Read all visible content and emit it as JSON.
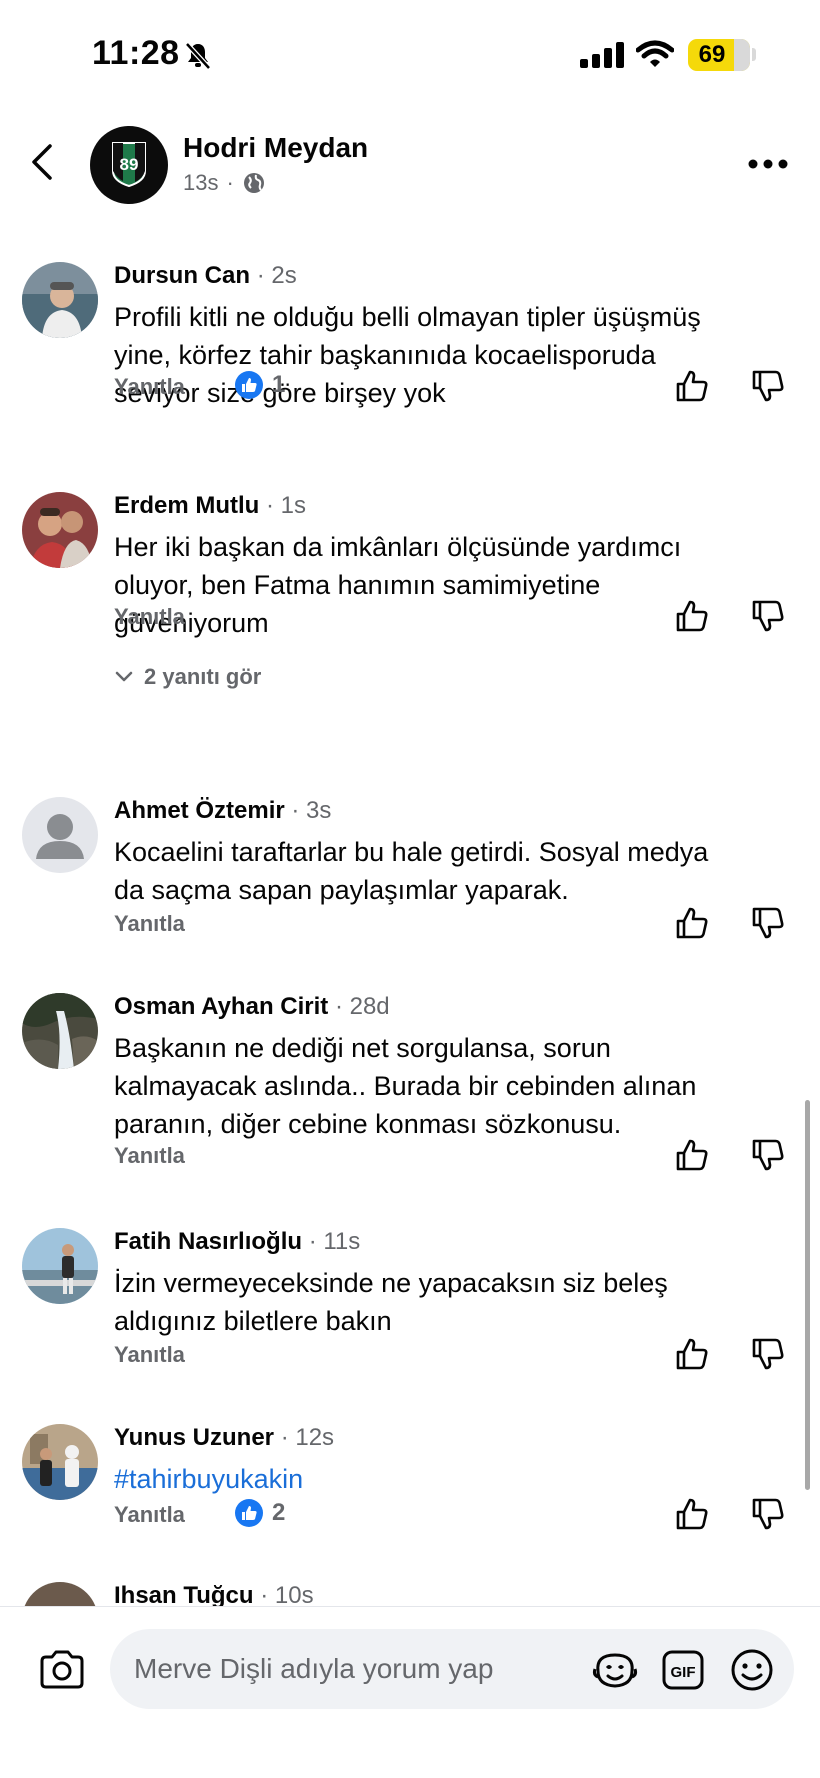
{
  "status": {
    "time": "11:28",
    "battery": "69"
  },
  "post_header": {
    "page_name": "Hodri Meydan",
    "page_avatar_text": "89",
    "time": "13s",
    "separator": "·"
  },
  "comments": [
    {
      "author": "Dursun Can",
      "time": "· 2s",
      "lines": [
        "Profili kitli ne olduğu belli olmayan tipler üşüşmüş",
        "yine, körfez tahir başkanınıda kocaelisporuda",
        "seviyor size göre birşey yok"
      ],
      "reply_label": "Yanıtla",
      "likes": "1"
    },
    {
      "author": "Erdem Mutlu",
      "time": "· 1s",
      "lines": [
        "Her iki başkan da imkânları ölçüsünde yardımcı",
        "oluyor, ben Fatma hanımın samimiyetine",
        "güveniyorum"
      ],
      "reply_label": "Yanıtla",
      "view_replies": "2 yanıtı gör"
    },
    {
      "author": "Ahmet Öztemir",
      "time": "· 3s",
      "lines": [
        "Kocaelini taraftarlar bu hale getirdi. Sosyal medya",
        "da saçma sapan paylaşımlar yaparak."
      ],
      "reply_label": "Yanıtla"
    },
    {
      "author": "Osman Ayhan Cirit",
      "time": "· 28d",
      "lines": [
        "Başkanın ne dediği net sorgulansa, sorun",
        "kalmayacak aslında.. Burada bir cebinden alınan",
        "paranın, diğer cebine konması sözkonusu."
      ],
      "reply_label": "Yanıtla"
    },
    {
      "author": "Fatih Nasırlıoğlu",
      "time": "· 11s",
      "lines": [
        "İzin vermeyeceksinde  ne yapacaksın  siz beleş",
        "aldıgınız biletlere bakın"
      ],
      "reply_label": "Yanıtla"
    },
    {
      "author": "Yunus Uzuner",
      "time": "· 12s",
      "lines": [
        "#tahirbuyukakin"
      ],
      "reply_label": "Yanıtla",
      "likes": "2"
    },
    {
      "author": "Ihsan Tuğcu",
      "time": "· 10s"
    }
  ],
  "composer": {
    "placeholder": "Merve Dişli adıyla yorum yap"
  },
  "colors": {
    "accent_blue": "#1877f2",
    "hashtag": "#1a6ed8",
    "secondary_text": "#65676b",
    "battery": "#f5d90a"
  },
  "icons": [
    "bell-slash-icon",
    "signal-icon",
    "wifi-icon",
    "back-icon",
    "globe-icon",
    "more-icon",
    "like-badge-icon",
    "thumb-up-icon",
    "thumb-down-icon",
    "chevron-down-icon",
    "camera-icon",
    "avatar-sticker-icon",
    "gif-icon",
    "emoji-icon"
  ]
}
